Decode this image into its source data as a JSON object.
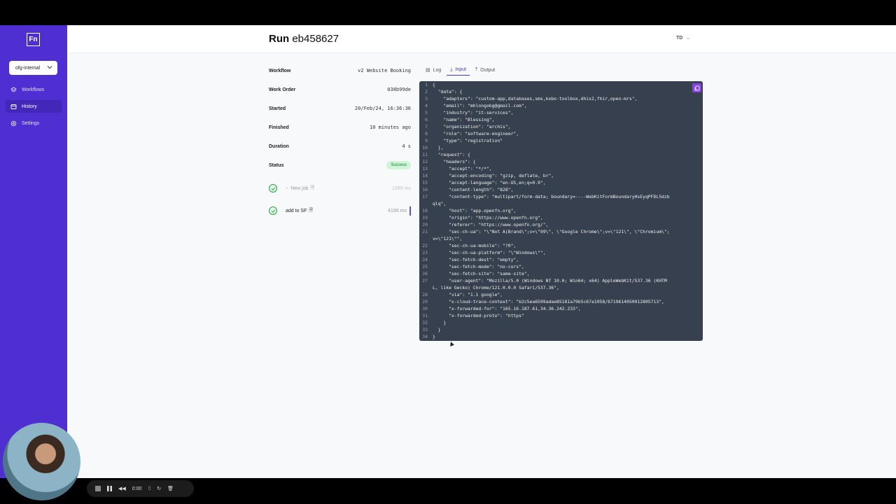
{
  "app": {
    "logo": "Fn",
    "project": "ofg-internal"
  },
  "nav": [
    {
      "label": "Workflows",
      "icon": "layers-icon"
    },
    {
      "label": "History",
      "icon": "history-icon",
      "active": true
    },
    {
      "label": "Settings",
      "icon": "gear-icon"
    }
  ],
  "header": {
    "title_prefix": "Run",
    "run_id": "eb458627",
    "user_initials": "TD"
  },
  "details": {
    "workflow_label": "Workflow",
    "workflow_value": "v2 Website Booking",
    "work_order_label": "Work Order",
    "work_order_value": "038b99de",
    "started_label": "Started",
    "started_value": "20/Feb/24, 16:36:36",
    "finished_label": "Finished",
    "finished_value": "10 minutes ago",
    "duration_label": "Duration",
    "duration_value": "4 s",
    "status_label": "Status",
    "status_value": "Success"
  },
  "steps": [
    {
      "name": "New job",
      "duration": "1289 ms"
    },
    {
      "name": "add to SF",
      "duration": "4196 ms"
    }
  ],
  "tabs": {
    "log": "Log",
    "input": "Input",
    "output": "Output"
  },
  "code_lines": [
    "{",
    "  \"data\": {",
    "    \"adaptors\": \"custom-app,databases,sms,kobo-toolbox,dhis2,fhir,open-mrs\",",
    "    \"email\": \"mhlongobg@gmail.com\",",
    "    \"industry\": \"it-services\",",
    "    \"name\": \"Blessing\",",
    "    \"organization\": \"archis\",",
    "    \"role\": \"software-engineer\",",
    "    \"type\": \"registration\"",
    "  },",
    "  \"request\": {",
    "    \"headers\": {",
    "      \"accept\": \"*/*\",",
    "      \"accept-encoding\": \"gzip, deflate, br\",",
    "      \"accept-language\": \"en-US,en;q=0.9\",",
    "      \"content-length\": \"828\",",
    "      \"content-type\": \"multipart/form-data; boundary=----WebKitFormBoundaryHsEyqPFDL5dzb\nqlq\",",
    "      \"host\": \"app.openfn.org\",",
    "      \"origin\": \"https://www.openfn.org\",",
    "      \"referer\": \"https://www.openfn.org/\",",
    "      \"sec-ch-ua\": \"\\\"Not A(Brand\\\";v=\\\"99\\\", \\\"Google Chrome\\\";v=\\\"121\\\", \\\"Chromium\\\";\nv=\\\"121\\\"\",",
    "      \"sec-ch-ua-mobile\": \"?0\",",
    "      \"sec-ch-ua-platform\": \"\\\"Windows\\\"\",",
    "      \"sec-fetch-dest\": \"empty\",",
    "      \"sec-fetch-mode\": \"no-cors\",",
    "      \"sec-fetch-site\": \"same-site\",",
    "      \"user-agent\": \"Mozilla/5.0 (Windows NT 10.0; Win64; x64) AppleWebKit/537.36 (KHTM\nL, like Gecko) Chrome/121.0.0.0 Safari/537.36\",",
    "      \"via\": \"1.1 google\",",
    "      \"x-cloud-trace-context\": \"b2c5ea6599adae85181a79b5c67a1058/6719614050912805713\",",
    "      \"x-forwarded-for\": \"165.16.187.61,34.36.242.233\",",
    "      \"x-forwarded-proto\": \"https\"",
    "    }",
    "  }",
    "}"
  ],
  "recorder": {
    "time": "0:00"
  },
  "colors": {
    "brand": "#4f2fd1",
    "success": "#2ba04a",
    "code_bg": "#36404f"
  }
}
